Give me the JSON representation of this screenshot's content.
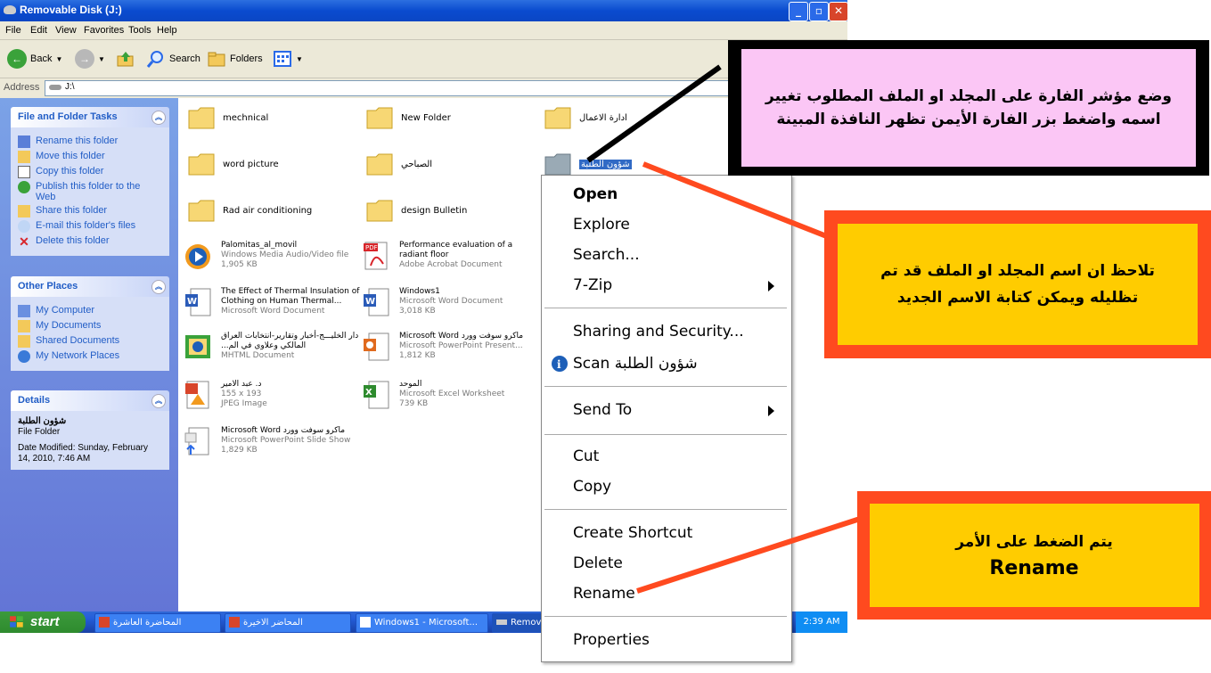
{
  "window": {
    "title": "Removable Disk (J:)"
  },
  "menu": [
    "File",
    "Edit",
    "View",
    "Favorites",
    "Tools",
    "Help"
  ],
  "toolbar": {
    "back": "Back",
    "search": "Search",
    "folders": "Folders"
  },
  "address": {
    "label": "Address",
    "value": "J:\\"
  },
  "tasks": {
    "file_folder": {
      "title": "File and Folder Tasks",
      "items": [
        "Rename this folder",
        "Move this folder",
        "Copy this folder",
        "Publish this folder to the Web",
        "Share this folder",
        "E-mail this folder's files",
        "Delete this folder"
      ]
    },
    "other_places": {
      "title": "Other Places",
      "items": [
        "My Computer",
        "My Documents",
        "Shared Documents",
        "My Network Places"
      ]
    },
    "details": {
      "title": "Details",
      "name": "شؤون الطلبة",
      "type": "File Folder",
      "modified": "Date Modified: Sunday, February 14, 2010, 7:46 AM"
    }
  },
  "folders": [
    {
      "name": "mechnical"
    },
    {
      "name": "New Folder"
    },
    {
      "name": "ادارة الاعمال"
    },
    {
      "name": "word picture"
    },
    {
      "name": "الصباحي"
    },
    {
      "name": "شؤون الطلبة"
    },
    {
      "name": "Rad air conditioning"
    },
    {
      "name": "design Bulletin"
    }
  ],
  "files": [
    {
      "name": "Palomitas_al_movil",
      "type": "Windows Media Audio/Video file",
      "size": "1,905 KB"
    },
    {
      "name": "Performance evaluation of a radiant floor",
      "type": "Adobe Acrobat Document",
      "size": ""
    },
    {
      "name": "The Effect of Thermal Insulation of Clothing on Human Thermal...",
      "type": "Microsoft Word Document",
      "size": ""
    },
    {
      "name": "Windows1",
      "type": "Microsoft Word Document",
      "size": "3,018 KB"
    },
    {
      "name": "دار الخليـــج-أخبار وتقارير-انتخابات العراق المالكي وعلاوي في الم...",
      "type": "MHTML Document",
      "size": ""
    },
    {
      "name": "Microsoft Word ماكرو سوفت وورد",
      "type": "Microsoft PowerPoint Present...",
      "size": "1,812 KB"
    },
    {
      "name": "د. عبد الامير",
      "type": "155 x 193",
      "size": "JPEG Image"
    },
    {
      "name": "الموحد",
      "type": "Microsoft Excel Worksheet",
      "size": "739 KB"
    },
    {
      "name": "Microsoft Word ماكرو سوفت وورد",
      "type": "Microsoft PowerPoint Slide Show",
      "size": "1,829 KB"
    }
  ],
  "file_icons": [
    "wmv-icon",
    "pdf-icon",
    "word-doc-icon",
    "word-doc-icon",
    "mhtml-icon",
    "powerpoint-icon",
    "jpeg-icon",
    "excel-icon",
    "powerpoint-show-icon"
  ],
  "context_menu": {
    "open": "Open",
    "explore": "Explore",
    "search": "Search...",
    "zip": "7-Zip",
    "sharing": "Sharing and Security...",
    "scan": "Scan شؤون الطلبة",
    "send_to": "Send To",
    "cut": "Cut",
    "copy": "Copy",
    "create_shortcut": "Create Shortcut",
    "delete": "Delete",
    "rename": "Rename",
    "properties": "Properties"
  },
  "taskbar": {
    "start": "start",
    "items": [
      "المحاضرة العاشرة",
      "المحاضر الاخيرة",
      "Windows1 - Microsoft...",
      "Remov"
    ],
    "clock": "2:39 AM"
  },
  "callouts": {
    "top": "وضع مؤشر الفارة على المجلد او الملف المطلوب تغيير اسمه واضغط بزر الفارة الأيمن تظهر النافذة المبينة",
    "middle": "تلاحظ ان اسم المجلد او الملف قد تم تظليله ويمكن كتابة الاسم الجديد",
    "bottom_line1": "يتم الضغط على الأمر",
    "bottom_line2": "Rename"
  },
  "colors": {
    "accent_blue": "#0a4bcf",
    "callout_pink": "#fbc6f5",
    "callout_yellow": "#ffcc00",
    "callout_border": "#ff4a1f"
  }
}
